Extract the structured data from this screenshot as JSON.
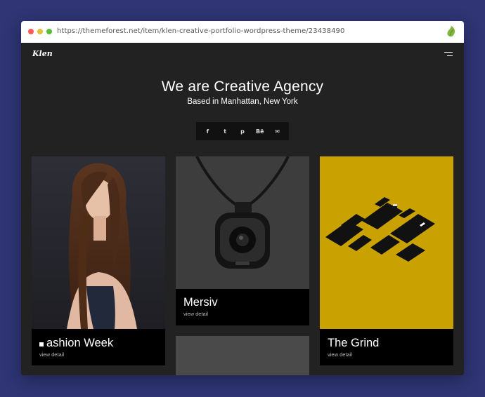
{
  "browser": {
    "url": "https://themeforest.net/item/klen-creative-portfolio-wordpress-theme/23438490"
  },
  "site": {
    "logo": "Klen",
    "hero_title": "We are Creative Agency",
    "hero_subtitle": "Based in Manhattan, New York"
  },
  "social": [
    {
      "icon": "facebook-icon",
      "glyph": "f"
    },
    {
      "icon": "twitter-icon",
      "glyph": "t"
    },
    {
      "icon": "pinterest-icon",
      "glyph": "p"
    },
    {
      "icon": "behance-icon",
      "glyph": "Bē"
    },
    {
      "icon": "mail-icon",
      "glyph": "✉"
    }
  ],
  "portfolio": [
    {
      "title": "ashion Week",
      "detail": "view detail"
    },
    {
      "title": "Mersiv",
      "detail": "view detail"
    },
    {
      "title": "The Grind",
      "detail": "view detail"
    }
  ],
  "colors": {
    "page_bg": "#2f3575",
    "site_bg": "#222222",
    "accent_yellow": "#c9a100"
  }
}
